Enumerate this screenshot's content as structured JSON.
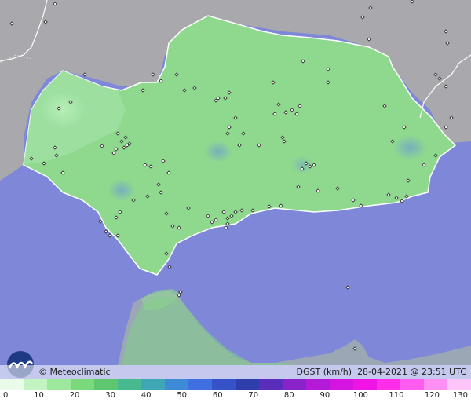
{
  "footer": {
    "brand": "© Meteoclimatic",
    "caption": "DGST (km/h)  28-04-2021 @ 23:51 UTC"
  },
  "scale": {
    "labels": [
      "0",
      "10",
      "20",
      "30",
      "40",
      "50",
      "60",
      "70",
      "80",
      "90",
      "100",
      "110",
      "120",
      "130"
    ],
    "colors": [
      "#e9fbe9",
      "#c3f2c3",
      "#9ee89e",
      "#7ad97a",
      "#5cc76e",
      "#49b98f",
      "#3fa6b6",
      "#3d8bd6",
      "#3f6fe0",
      "#3553c7",
      "#2f3eaa",
      "#5a2dbb",
      "#8a22c9",
      "#b21ad8",
      "#d514e0",
      "#f014e4",
      "#ff2de8",
      "#ff5df0",
      "#ff8ff4",
      "#ffc5f9"
    ]
  },
  "colors": {
    "sea": "#7f88d8",
    "land_andalucia": "#8fd98f",
    "land_other": "#a9a9ad",
    "border": "#ffffff"
  },
  "stations": {
    "count_label": ""
  }
}
